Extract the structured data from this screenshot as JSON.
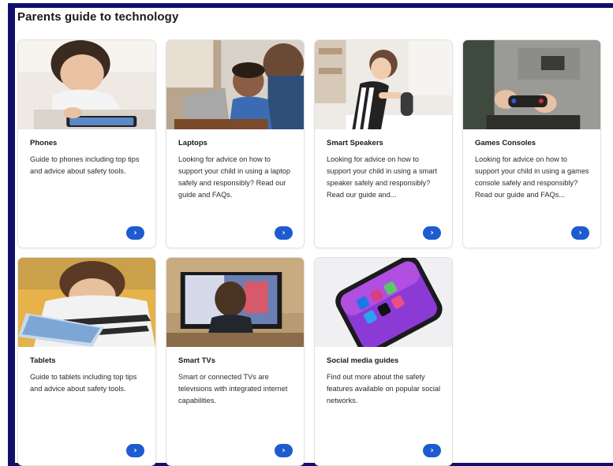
{
  "page": {
    "title": "Parents guide to technology",
    "accent_color": "#10106b",
    "button_color": "#1d5ccf"
  },
  "cards": [
    {
      "title": "Phones",
      "description": "Guide to phones including top tips and advice about safety tools.",
      "image": "child-using-phone-photo",
      "arrow_icon": "chevron-right-icon"
    },
    {
      "title": "Laptops",
      "description": "Looking for advice on how to support your child in using a laptop safely and responsibly? Read our guide and FAQs.",
      "image": "children-using-laptop-photo",
      "arrow_icon": "chevron-right-icon"
    },
    {
      "title": "Smart Speakers",
      "description": "Looking for advice on how to support your child in using a smart speaker safely and responsibly? Read our guide and...",
      "image": "child-with-smart-speaker-photo",
      "arrow_icon": "chevron-right-icon"
    },
    {
      "title": "Games Consoles",
      "description": "Looking for advice on how to support your child in using a games console safely and responsibly? Read our guide and FAQs...",
      "image": "child-with-game-controller-photo",
      "arrow_icon": "chevron-right-icon"
    },
    {
      "title": "Tablets",
      "description": "Guide to tablets including top tips and advice about safety tools.",
      "image": "child-using-tablet-photo",
      "arrow_icon": "chevron-right-icon"
    },
    {
      "title": "Smart TVs",
      "description": "Smart or connected TVs are televisions with integrated internet capabilities.",
      "image": "child-watching-tv-photo",
      "arrow_icon": "chevron-right-icon"
    },
    {
      "title": "Social media guides",
      "description": "Find out more about the safety features available on popular social networks.",
      "image": "phone-with-social-apps-photo",
      "arrow_icon": "chevron-right-icon"
    }
  ],
  "arrow_glyph": "›"
}
